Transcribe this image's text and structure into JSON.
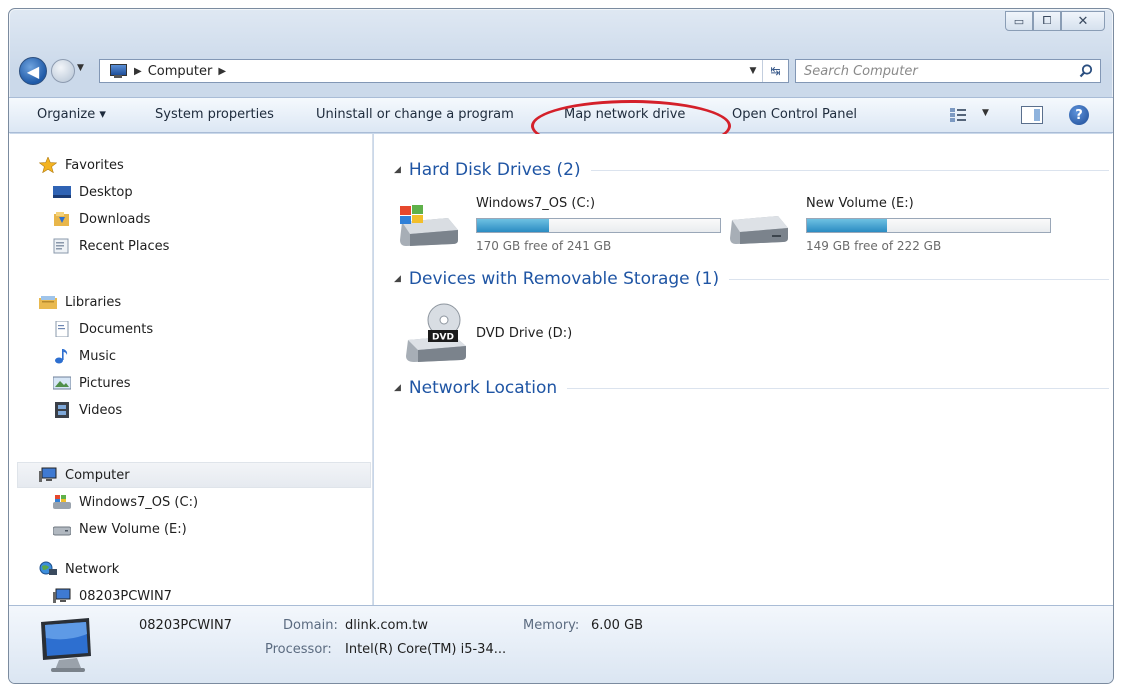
{
  "window": {
    "caption": {
      "minimize": "▭",
      "maximize": "⧠",
      "close": "✕"
    }
  },
  "address": {
    "crumb": "Computer",
    "search_placeholder": "Search Computer"
  },
  "toolbar": {
    "organize": "Organize ▾",
    "system_properties": "System properties",
    "uninstall": "Uninstall or change a program",
    "map_network_drive": "Map network drive",
    "open_control_panel": "Open Control Panel",
    "highlight_color": "#d4202a"
  },
  "nav": {
    "favorites": "Favorites",
    "desktop": "Desktop",
    "downloads": "Downloads",
    "recent": "Recent Places",
    "libraries": "Libraries",
    "documents": "Documents",
    "music": "Music",
    "pictures": "Pictures",
    "videos": "Videos",
    "computer": "Computer",
    "drive_c": "Windows7_OS (C:)",
    "drive_e": "New Volume (E:)",
    "network": "Network",
    "network_pc": "08203PCWIN7"
  },
  "content": {
    "hdd_heading": "Hard Disk Drives (2)",
    "removable_heading": "Devices with Removable Storage (1)",
    "network_heading": "Network Location",
    "drives": [
      {
        "name": "Windows7_OS (C:)",
        "free": "170 GB free of 241 GB",
        "used_fraction": 0.295
      },
      {
        "name": "New Volume (E:)",
        "free": "149 GB free of 222 GB",
        "used_fraction": 0.329
      }
    ],
    "dvd": {
      "name": "DVD Drive (D:)",
      "badge": "DVD"
    }
  },
  "details": {
    "pc_name": "08203PCWIN7",
    "domain_label": "Domain:",
    "domain_value": "dlink.com.tw",
    "memory_label": "Memory:",
    "memory_value": "6.00 GB",
    "processor_label": "Processor:",
    "processor_value": "Intel(R) Core(TM) i5-34..."
  }
}
